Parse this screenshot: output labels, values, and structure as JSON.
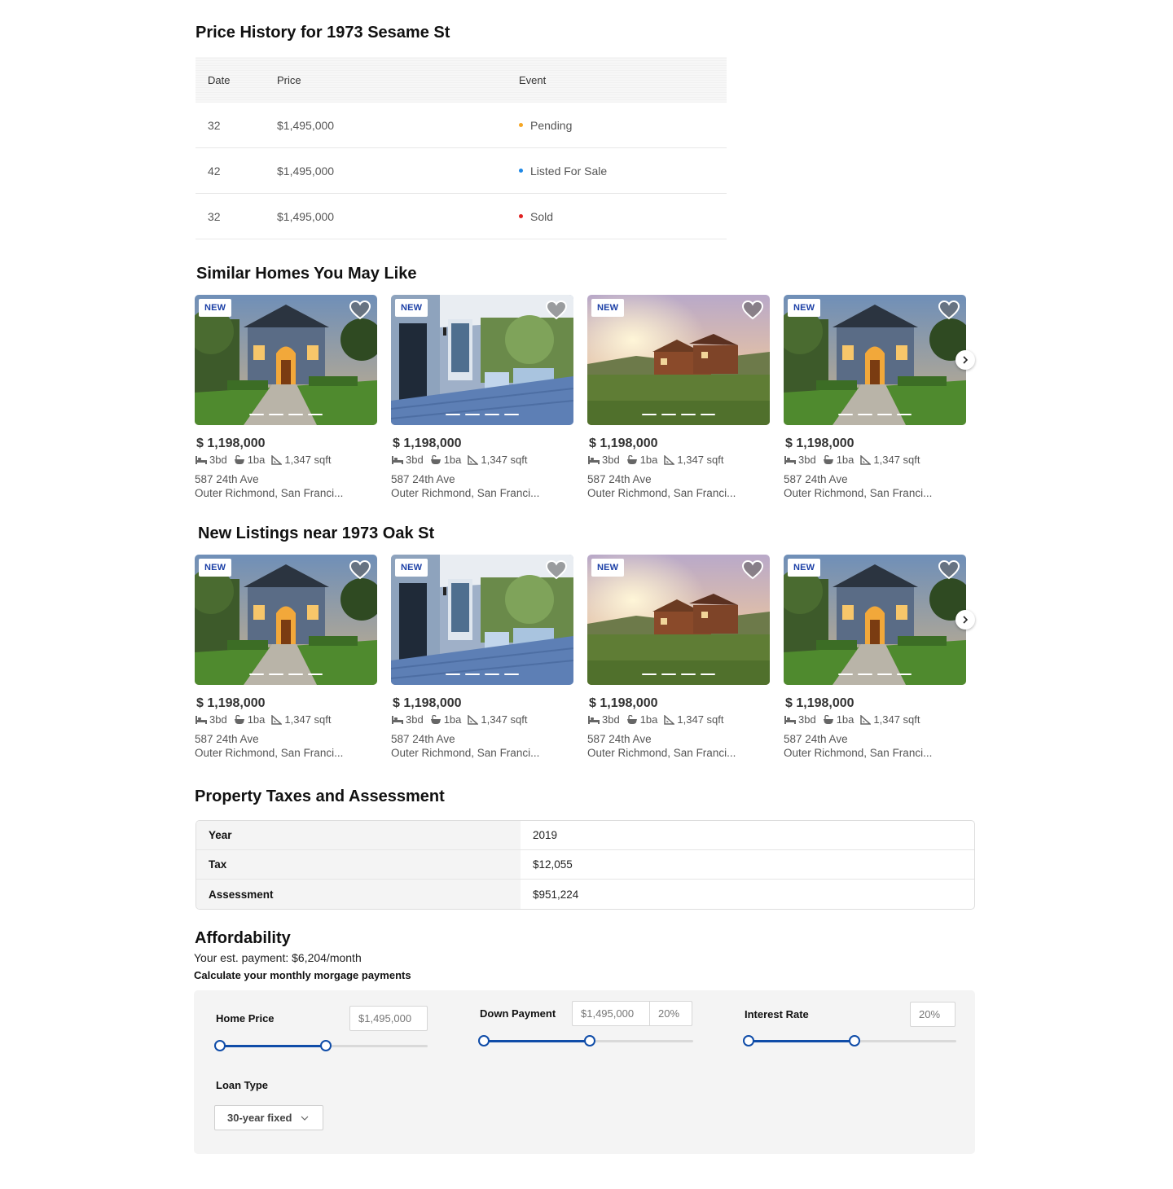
{
  "price_history": {
    "title": "Price History for 1973 Sesame St",
    "columns": [
      "Date",
      "Price",
      "Event"
    ],
    "rows": [
      {
        "date": "32",
        "price": "$1,495,000",
        "event": "Pending",
        "color": "#f5a623"
      },
      {
        "date": "42",
        "price": "$1,495,000",
        "event": "Listed For Sale",
        "color": "#1e88e5"
      },
      {
        "date": "32",
        "price": "$1,495,000",
        "event": "Sold",
        "color": "#e02020"
      }
    ]
  },
  "similar": {
    "title": "Similar Homes You May Like",
    "cards": [
      {
        "badge": "NEW",
        "price": "$ 1,198,000",
        "beds": "3bd",
        "baths": "1ba",
        "sqft": "1,347 sqft",
        "addr1": "587 24th Ave",
        "addr2": "Outer Richmond, San Franci..."
      },
      {
        "badge": "NEW",
        "price": "$ 1,198,000",
        "beds": "3bd",
        "baths": "1ba",
        "sqft": "1,347 sqft",
        "addr1": "587 24th Ave",
        "addr2": "Outer Richmond, San Franci..."
      },
      {
        "badge": "NEW",
        "price": "$ 1,198,000",
        "beds": "3bd",
        "baths": "1ba",
        "sqft": "1,347 sqft",
        "addr1": "587 24th Ave",
        "addr2": "Outer Richmond, San Franci..."
      },
      {
        "badge": "NEW",
        "price": "$ 1,198,000",
        "beds": "3bd",
        "baths": "1ba",
        "sqft": "1,347 sqft",
        "addr1": "587 24th Ave",
        "addr2": "Outer Richmond, San Franci..."
      }
    ]
  },
  "new_listings": {
    "title": "New Listings near 1973 Oak St",
    "cards": [
      {
        "badge": "NEW",
        "price": "$ 1,198,000",
        "beds": "3bd",
        "baths": "1ba",
        "sqft": "1,347 sqft",
        "addr1": "587 24th Ave",
        "addr2": "Outer Richmond, San Franci..."
      },
      {
        "badge": "NEW",
        "price": "$ 1,198,000",
        "beds": "3bd",
        "baths": "1ba",
        "sqft": "1,347 sqft",
        "addr1": "587 24th Ave",
        "addr2": "Outer Richmond, San Franci..."
      },
      {
        "badge": "NEW",
        "price": "$ 1,198,000",
        "beds": "3bd",
        "baths": "1ba",
        "sqft": "1,347 sqft",
        "addr1": "587 24th Ave",
        "addr2": "Outer Richmond, San Franci..."
      },
      {
        "badge": "NEW",
        "price": "$ 1,198,000",
        "beds": "3bd",
        "baths": "1ba",
        "sqft": "1,347 sqft",
        "addr1": "587 24th Ave",
        "addr2": "Outer Richmond, San Franci..."
      }
    ]
  },
  "taxes": {
    "title": "Property Taxes and Assessment",
    "rows": [
      {
        "key": "Year",
        "value": "2019"
      },
      {
        "key": "Tax",
        "value": "$12,055"
      },
      {
        "key": "Assessment",
        "value": "$951,224"
      }
    ]
  },
  "affordability": {
    "title": "Affordability",
    "est_payment": "Your est. payment: $6,204/month",
    "calc_title": "Calculate your monthly morgage payments",
    "home_price": {
      "label": "Home Price",
      "value": "$1,495,000"
    },
    "down_payment": {
      "label": "Down Payment",
      "value": "$1,495,000",
      "percent": "20%"
    },
    "interest_rate": {
      "label": "Interest Rate",
      "value": "20%"
    },
    "loan_type": {
      "label": "Loan Type",
      "selected": "30-year fixed"
    }
  },
  "colors": {
    "accent": "#0f4ca8",
    "badge_text": "#1b3fa6"
  }
}
